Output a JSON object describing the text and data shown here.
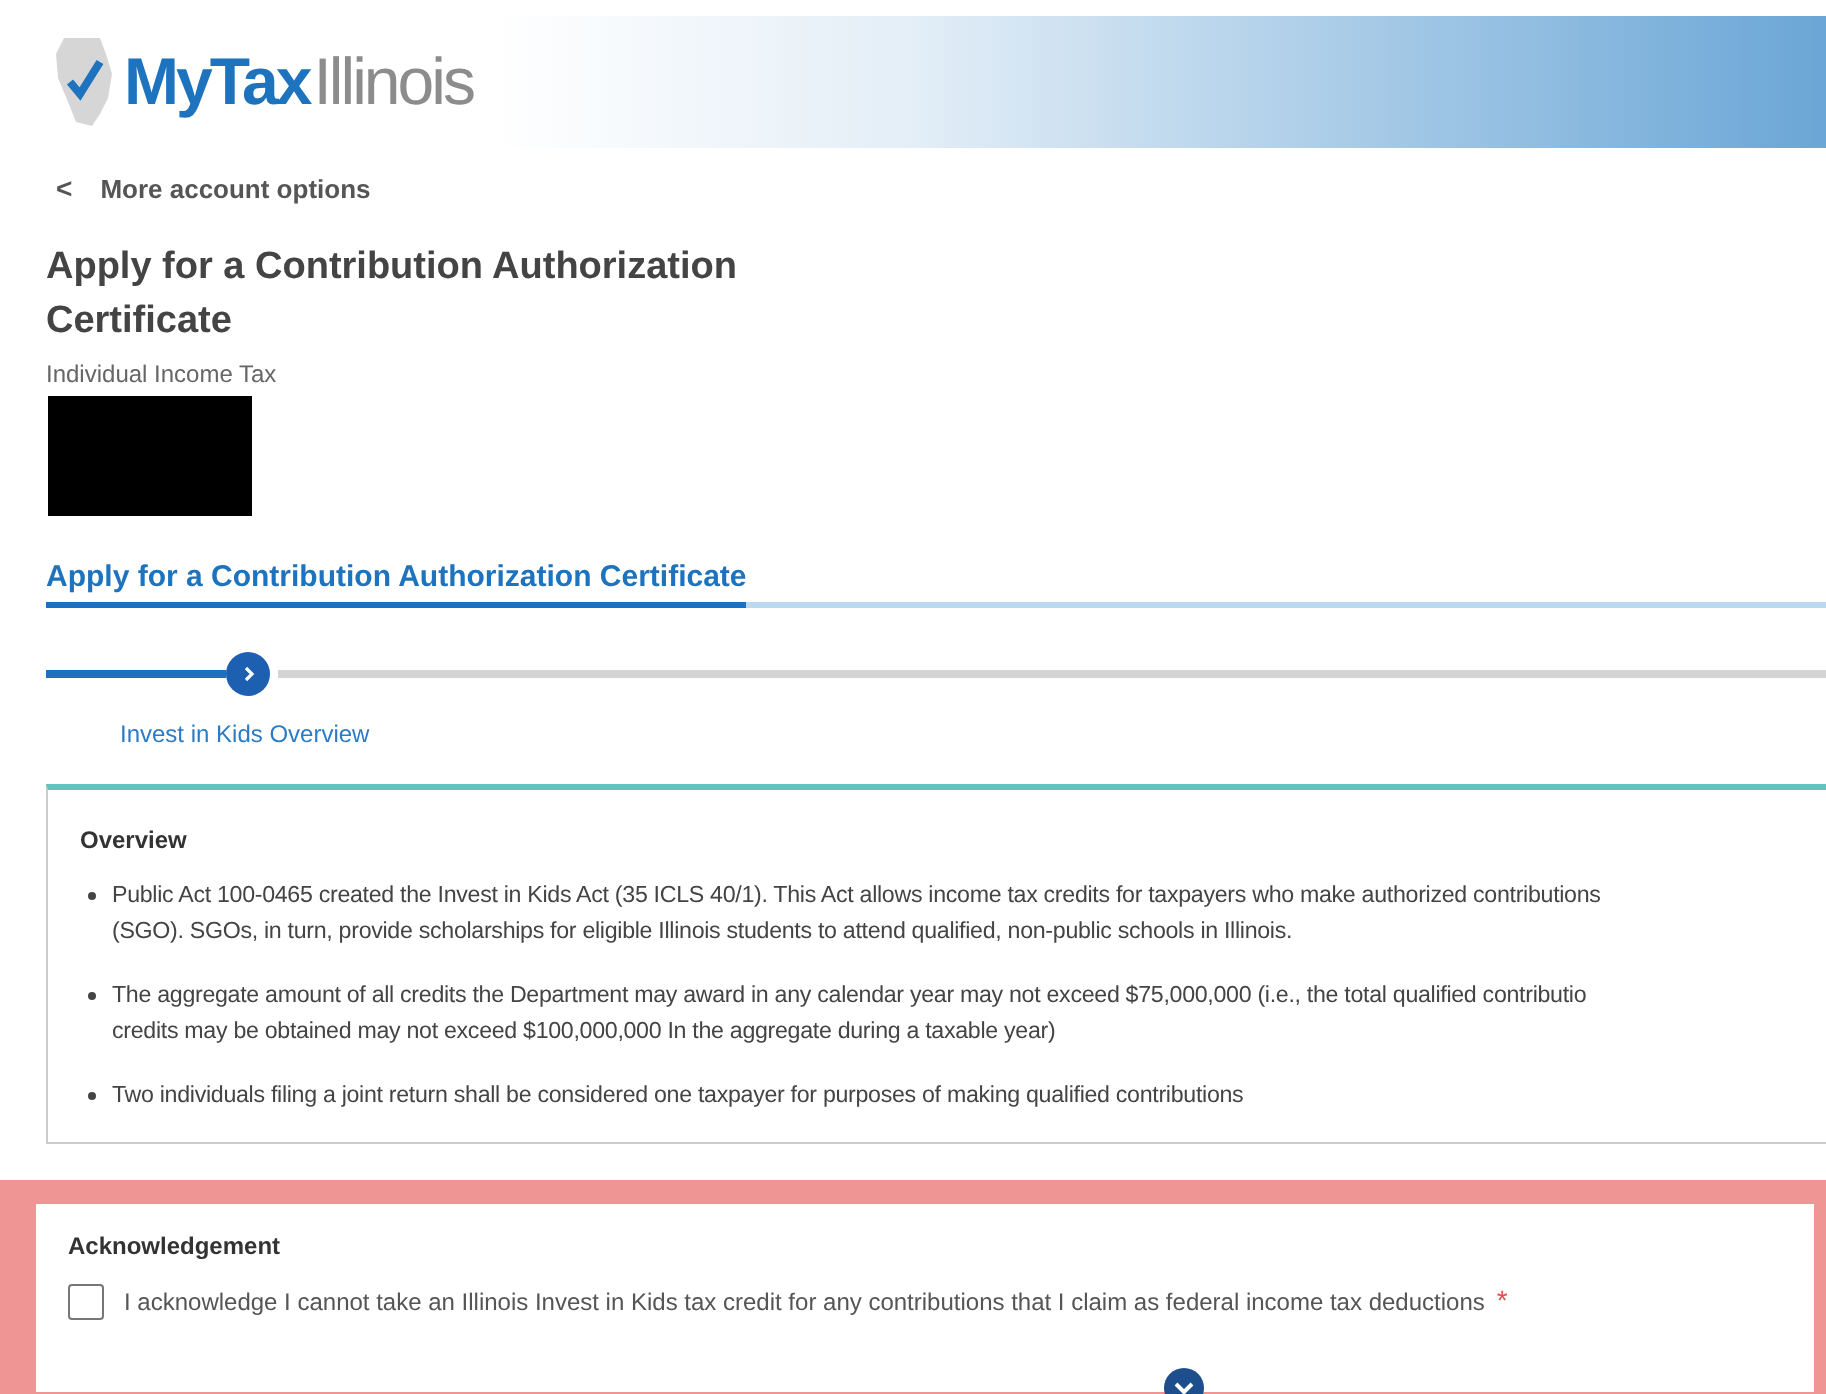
{
  "header": {
    "logo_primary": "MyTax",
    "logo_secondary": "Illinois"
  },
  "back_link": {
    "icon": "<",
    "label": "More account options"
  },
  "page_title": "Apply for a Contribution Authorization Certificate",
  "subtitle": "Individual Income Tax",
  "section_tab": "Apply for a Contribution Authorization Certificate",
  "stepper": {
    "steps": [
      {
        "label": "Invest in Kids Overview",
        "selected": true
      }
    ]
  },
  "overview": {
    "title": "Overview",
    "bullets": [
      {
        "lines": [
          "Public Act 100-0465 created the Invest in Kids Act (35 ICLS 40/1). This Act allows income tax credits for taxpayers who make authorized contributions",
          "(SGO). SGOs, in turn, provide scholarships for eligible Illinois students to attend qualified, non-public schools in Illinois."
        ]
      },
      {
        "lines": [
          "The aggregate amount of all credits the Department may award in any calendar year may not exceed $75,000,000 (i.e., the total qualified contributio",
          "credits may be obtained may not exceed $100,000,000 In the aggregate during a taxable year)"
        ]
      },
      {
        "lines": [
          "Two individuals filing a joint return shall be considered one taxpayer for purposes of making qualified contributions"
        ]
      }
    ]
  },
  "acknowledgement": {
    "title": "Acknowledgement",
    "checked": false,
    "label": "I acknowledge I cannot take an Illinois Invest in Kids tax credit for any contributions that I claim as federal income tax deductions",
    "required_mark": "*"
  }
}
